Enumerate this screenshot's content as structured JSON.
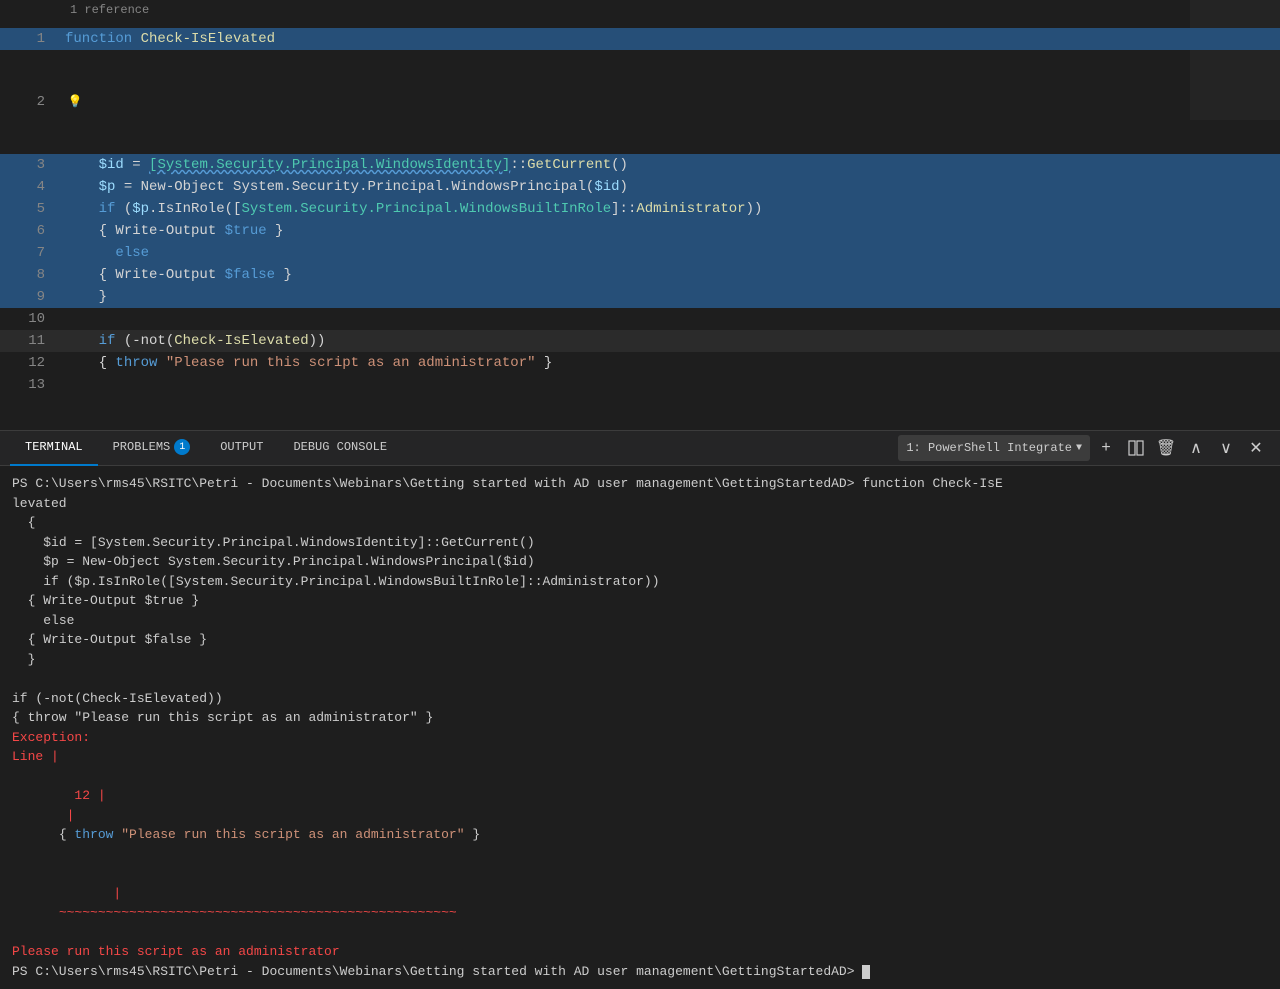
{
  "editor": {
    "reference_text": "1 reference",
    "lines": [
      {
        "num": 1,
        "type": "function_decl",
        "selected": true
      },
      {
        "num": 2,
        "type": "lightbulb"
      },
      {
        "num": 3,
        "type": "id_assign",
        "selected": true
      },
      {
        "num": 4,
        "type": "p_assign",
        "selected": true
      },
      {
        "num": 5,
        "type": "if_role",
        "selected": true
      },
      {
        "num": 6,
        "type": "write_true",
        "selected": true
      },
      {
        "num": 7,
        "type": "else",
        "selected": true
      },
      {
        "num": 8,
        "type": "write_false",
        "selected": true
      },
      {
        "num": 9,
        "type": "close_brace",
        "selected": true
      },
      {
        "num": 10,
        "type": "empty"
      },
      {
        "num": 11,
        "type": "if_check",
        "selected": false
      },
      {
        "num": 12,
        "type": "throw_line",
        "selected": false
      },
      {
        "num": 13,
        "type": "empty"
      }
    ]
  },
  "terminal": {
    "tabs": [
      {
        "label": "TERMINAL",
        "active": true
      },
      {
        "label": "PROBLEMS",
        "badge": "1",
        "active": false
      },
      {
        "label": "OUTPUT",
        "active": false
      },
      {
        "label": "DEBUG CONSOLE",
        "active": false
      }
    ],
    "dropdown_label": "1: PowerShell Integrate",
    "output": {
      "ps_prompt1": "PS C:\\Users\\rms45\\RSITC\\Petri - Documents\\Webinars\\Getting started with AD user management\\GettingStartedAD> function Check-IsElevated",
      "block_open": "  {",
      "line_id": "    $id = [System.Security.Principal.WindowsIdentity]::GetCurrent()",
      "line_p": "    $p = New-Object System.Security.Principal.WindowsPrincipal($id)",
      "line_if": "    if ($p.IsInRole([System.Security.Principal.WindowsBuiltInRole]::Administrator))",
      "line_true": "  { Write-Output $true }",
      "line_else": "    else",
      "line_false": "  { Write-Output $false }",
      "block_close": "  }",
      "empty1": "",
      "line_ifcheck": "if (-not(Check-IsElevated))",
      "line_throw": "{ throw \"Please run this script as an administrator\" }",
      "exception_header": "Exception:",
      "line_label": "Line |",
      "line_num": "  12 |",
      "line_throw_code": "    { throw \"Please run this script as an administrator\" }",
      "squiggles": "       ~~~~~~~~~~~~~~~~~~~~~~~~~~~~~~~~~~~~~~~~~~~~~~~~~~~",
      "error_msg": "Please run this script as an administrator",
      "ps_prompt2": "PS C:\\Users\\rms45\\RSITC\\Petri - Documents\\Webinars\\Getting started with AD user management\\GettingStartedAD>"
    }
  }
}
